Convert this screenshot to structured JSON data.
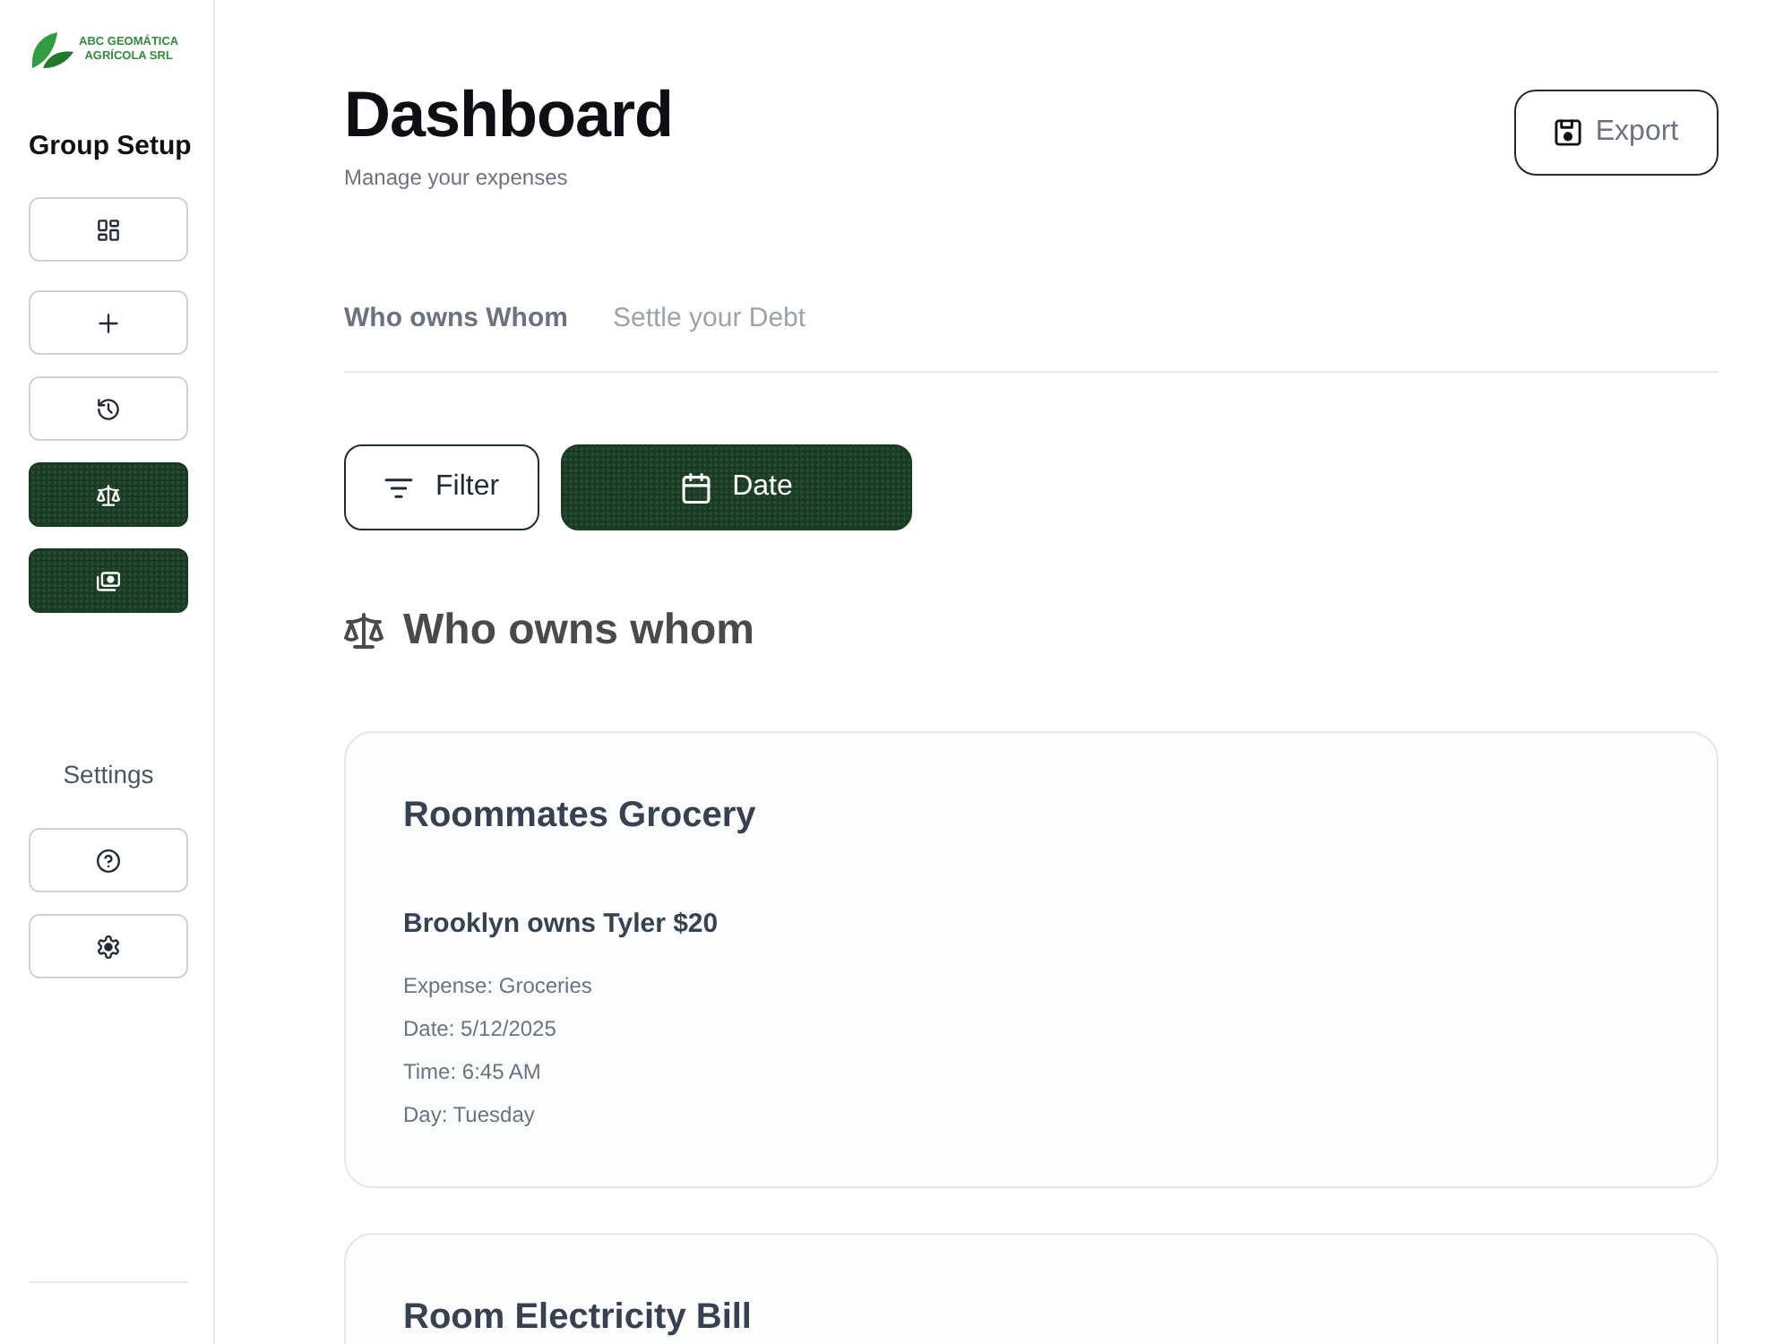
{
  "sidebar": {
    "logo": {
      "lines": [
        "ABC GEOMÁTICA",
        "AGRÍCOLA SRL"
      ]
    },
    "group_setup": {
      "title": "Group Setup",
      "items": [
        {
          "kind": "dashboard",
          "selected": false
        },
        {
          "kind": "add",
          "selected": false
        },
        {
          "kind": "history",
          "selected": false
        },
        {
          "kind": "balance",
          "selected": true
        },
        {
          "kind": "cash",
          "selected": true
        }
      ]
    },
    "settings": {
      "title": "Settings",
      "items": [
        {
          "kind": "help",
          "selected": false
        },
        {
          "kind": "settings",
          "selected": false
        }
      ]
    }
  },
  "header": {
    "title": "Dashboard",
    "subtitle": "Manage your expenses",
    "export_button": {
      "label": "Export"
    }
  },
  "tabs": [
    {
      "label": "Who owns Whom",
      "selected": true
    },
    {
      "label": "Settle your Debt",
      "selected": false
    }
  ],
  "filters": [
    {
      "kind": "filter",
      "label": "Filter",
      "selected": false
    },
    {
      "kind": "date",
      "label": "Date",
      "selected": true
    }
  ],
  "section": {
    "title": "Who owns whom"
  },
  "cards": [
    {
      "title": "Roommates Grocery",
      "summary": "Brooklyn owns Tyler $20",
      "details": [
        "Expense: Groceries",
        "Date: 5/12/2025",
        "Time: 6:45 AM",
        "Day: Tuesday"
      ]
    },
    {
      "title": "Room Electricity Bill"
    }
  ]
}
